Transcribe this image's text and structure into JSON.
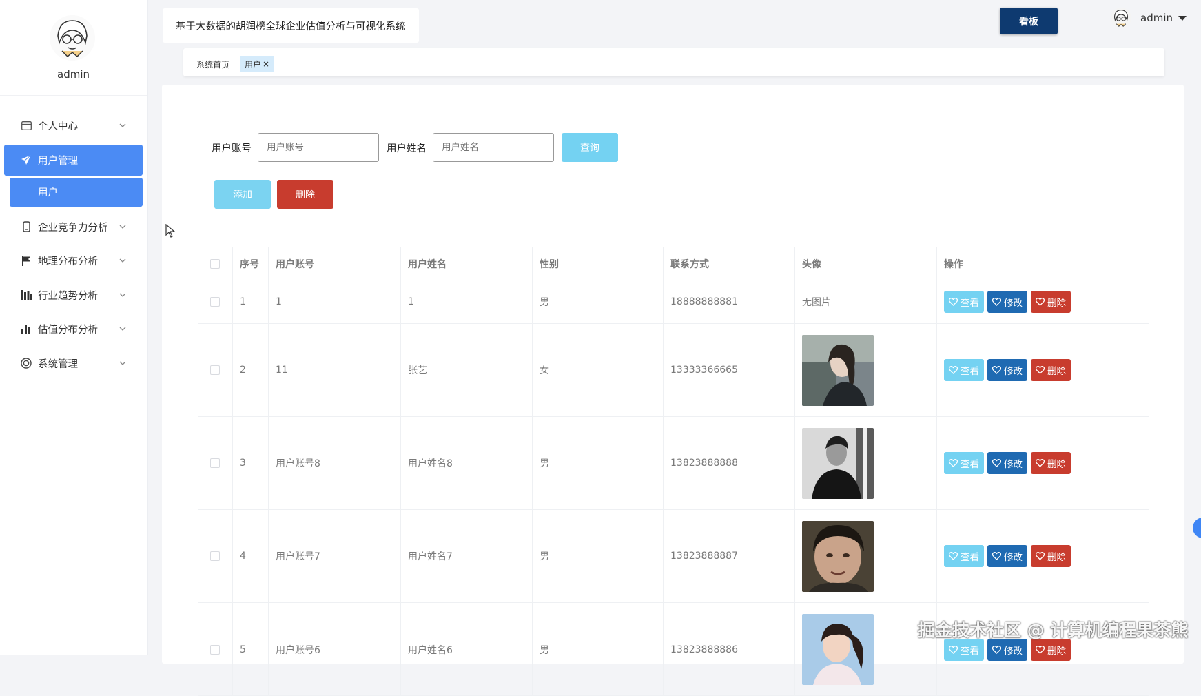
{
  "sidebar": {
    "username": "admin",
    "menu": [
      {
        "label": "个人中心",
        "icon": "card-icon"
      },
      {
        "label": "用户管理",
        "icon": "paper-plane-icon",
        "active": true,
        "sub": "用户"
      },
      {
        "label": "企业竞争力分析",
        "icon": "phone-icon"
      },
      {
        "label": "地理分布分析",
        "icon": "flag-icon"
      },
      {
        "label": "行业趋势分析",
        "icon": "bar-columns-icon"
      },
      {
        "label": "估值分布分析",
        "icon": "bar-chart-icon"
      },
      {
        "label": "系统管理",
        "icon": "circle-settings-icon"
      }
    ]
  },
  "header": {
    "title": "基于大数据的胡润榜全球企业估值分析与可视化系统",
    "board_button": "看板",
    "user": "admin"
  },
  "tags": {
    "home": "系统首页",
    "current": "用户",
    "close": "×"
  },
  "search": {
    "account_label": "用户账号",
    "account_placeholder": "用户账号",
    "name_label": "用户姓名",
    "name_placeholder": "用户姓名",
    "query_button": "查询"
  },
  "actions": {
    "add": "添加",
    "delete": "删除"
  },
  "table": {
    "headers": [
      "序号",
      "用户账号",
      "用户姓名",
      "性别",
      "联系方式",
      "头像",
      "操作"
    ],
    "ops": {
      "view": "查看",
      "edit": "修改",
      "delete": "删除"
    },
    "rows": [
      {
        "index": "1",
        "account": "1",
        "name": "1",
        "gender": "男",
        "phone": "18888888881",
        "avatar": "无图片"
      },
      {
        "index": "2",
        "account": "11",
        "name": "张艺",
        "gender": "女",
        "phone": "13333366665",
        "avatar": ""
      },
      {
        "index": "3",
        "account": "用户账号8",
        "name": "用户姓名8",
        "gender": "男",
        "phone": "13823888888",
        "avatar": ""
      },
      {
        "index": "4",
        "account": "用户账号7",
        "name": "用户姓名7",
        "gender": "男",
        "phone": "13823888887",
        "avatar": ""
      },
      {
        "index": "5",
        "account": "用户账号6",
        "name": "用户姓名6",
        "gender": "男",
        "phone": "13823888886",
        "avatar": ""
      }
    ]
  },
  "watermark": "掘金技术社区 @ 计算机编程果茶熊",
  "colors": {
    "primary": "#4b8bf4",
    "board": "#0e3a70",
    "light_blue": "#74d2f2",
    "edit_blue": "#1f6ab2",
    "danger": "#c83c2e"
  }
}
